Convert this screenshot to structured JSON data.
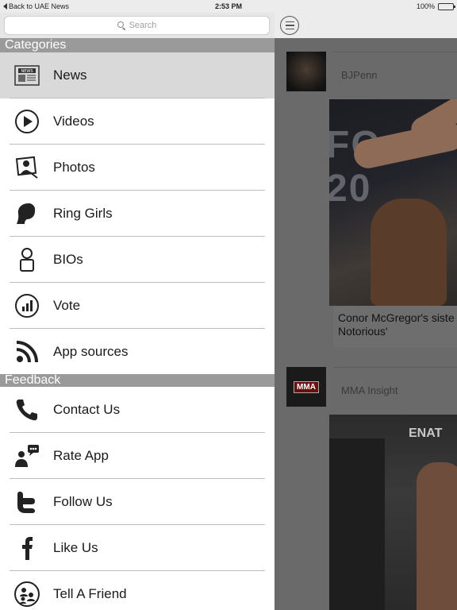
{
  "status_bar": {
    "back_label": "Back to UAE News",
    "time": "2:53 PM",
    "battery": "100%"
  },
  "search": {
    "placeholder": "Search"
  },
  "sections": {
    "categories": "Categories",
    "feedback": "Feedback"
  },
  "categories": [
    {
      "label": "News",
      "icon": "newspaper-icon",
      "selected": true
    },
    {
      "label": "Videos",
      "icon": "play-icon"
    },
    {
      "label": "Photos",
      "icon": "photo-frame-icon"
    },
    {
      "label": "Ring Girls",
      "icon": "girl-silhouette-icon"
    },
    {
      "label": "BIOs",
      "icon": "person-icon"
    },
    {
      "label": "Vote",
      "icon": "bar-chart-icon"
    },
    {
      "label": "App sources",
      "icon": "rss-icon"
    }
  ],
  "feedback": [
    {
      "label": "Contact Us",
      "icon": "phone-icon"
    },
    {
      "label": "Rate App",
      "icon": "rate-person-icon"
    },
    {
      "label": "Follow Us",
      "icon": "twitter-icon"
    },
    {
      "label": "Like Us",
      "icon": "facebook-icon"
    },
    {
      "label": "Tell A Friend",
      "icon": "share-people-icon"
    }
  ],
  "feed": [
    {
      "source": "BJPenn",
      "caption": "Conor McGregor's siste Notorious'"
    },
    {
      "source": "MMA Insight",
      "logo_text": "MMA"
    }
  ],
  "colors": {
    "drawer_bg": "#ffffff",
    "section_header_bg": "#9a9a9a",
    "selected_bg": "#d9d9d9",
    "overlay_bg": "#6a6a6a"
  }
}
